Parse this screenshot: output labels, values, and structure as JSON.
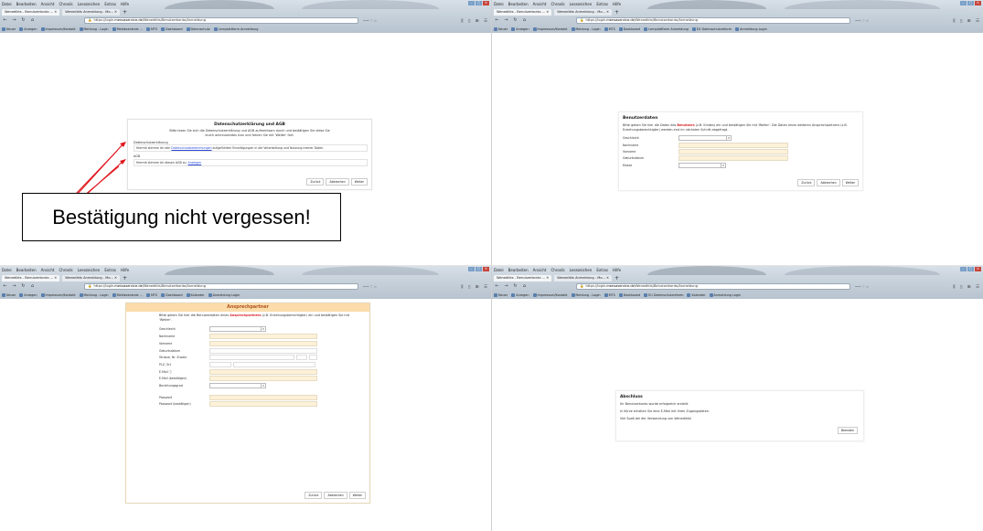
{
  "browser": {
    "menu": [
      "Datei",
      "Bearbeiten",
      "Ansicht",
      "Chronik",
      "Lesezeichen",
      "Extras",
      "Hilfe"
    ],
    "tabs": [
      {
        "label": "Wenedikts - Benutzerkonto ... ✕",
        "active": true
      },
      {
        "label": "Wenedikts Anmeldung - Mo... ✕",
        "active": false
      }
    ],
    "new_tab": "+",
    "window_controls": {
      "minimize": "–",
      "maximize": "□",
      "close": "✕"
    },
    "url_prefix": "https://login.",
    "url_host": "mensaservice.de",
    "url_path": "/Wenedikts/Benutzerkonto/Anmeldung",
    "url_actions": "••• ♡ ☆",
    "tools": "⫼ ▯ ⊞ ☰",
    "bookmarks": [
      "Neuer",
      "Anregen",
      "Impressum/Kontakt",
      "Meldung - Login",
      "Meldezentrale ...",
      "MTS",
      "Dashboard",
      "Datenschutz",
      "Lernplattform Anmeldung",
      "EU Datenschutzreform",
      "Kalender",
      "Anmeldung Login"
    ]
  },
  "q1": {
    "title": "Datenschutzerklärung und AGB",
    "intro": "Bitte lesen Sie sich die Datenschutzerklärung und AGB aufmerksam durch und bestätigen Sie diese Sie durch ankreuzendes Icon und fahren Sie mit 'Weiter' fort.",
    "section1_label": "Datenschutzerklärung",
    "section1_text_a": "Hiermit stimme ich den ",
    "section1_link": "Datenschutzbestimmungen",
    "section1_text_b": " aufgeführten Einwilligungen in die Verarbeitung und Nutzung meiner Daten.",
    "section2_label": "AGB",
    "section2_text_a": "Hiermit stimme ich diesen AGB zu: ",
    "section2_link": "Anzeigen",
    "buttons": {
      "back": "Zurück",
      "cancel": "Abbrechen",
      "next": "Weiter"
    },
    "callout": "Bestätigung nicht vergessen!"
  },
  "q2": {
    "title": "Benutzerdaten",
    "intro_a": "Bitte geben Sie hier die Daten des ",
    "intro_highlight": "Benutzers",
    "intro_b": " (z.B. Kindes) ein und bestätigen Sie mit 'Weiter'. Die Daten eines weiteren Ansprechpartners (z.B. Erziehungsberechtigter) werden erst im nächsten Schritt abgefragt.",
    "fields": [
      "Geschlecht",
      "Nachname",
      "Vorname",
      "Geburtsdatum",
      "Klasse"
    ],
    "buttons": {
      "back": "Zurück",
      "cancel": "Abbrechen",
      "next": "Weiter"
    }
  },
  "q3": {
    "title": "Ansprechpartner",
    "intro_a": "Bitte geben Sie hier die Benutzerdaten eines ",
    "intro_highlight": "Ansprechpartners",
    "intro_b": " (z.B. Erziehungsberechtigter) ein und bestätigen Sie mit 'Weiter'.",
    "fields": [
      "Geschlecht",
      "Nachname",
      "Vorname",
      "Geburtsdatum",
      "Strasse, Nr. Zusatz",
      "PLZ, Ort",
      "E-Mail ⓘ",
      "E-Mail (bestätigen)",
      "Beziehungsgrad"
    ],
    "password_fields": [
      "Passwort",
      "Passwort (bestätigen)"
    ],
    "buttons": {
      "back": "Zurück",
      "cancel": "Abbrechen",
      "next": "Weiter"
    }
  },
  "q4": {
    "title": "Abschluss",
    "line1": "Ihr Benutzerkonto wurde erfolgreich erstellt.",
    "line2": "In Kürze erhalten Sie eine E-Mail mit Ihren Zugangsdaten.",
    "line3": "Viel Spaß bei der Verwendung von Wenedikts!",
    "button": "Beenden"
  }
}
